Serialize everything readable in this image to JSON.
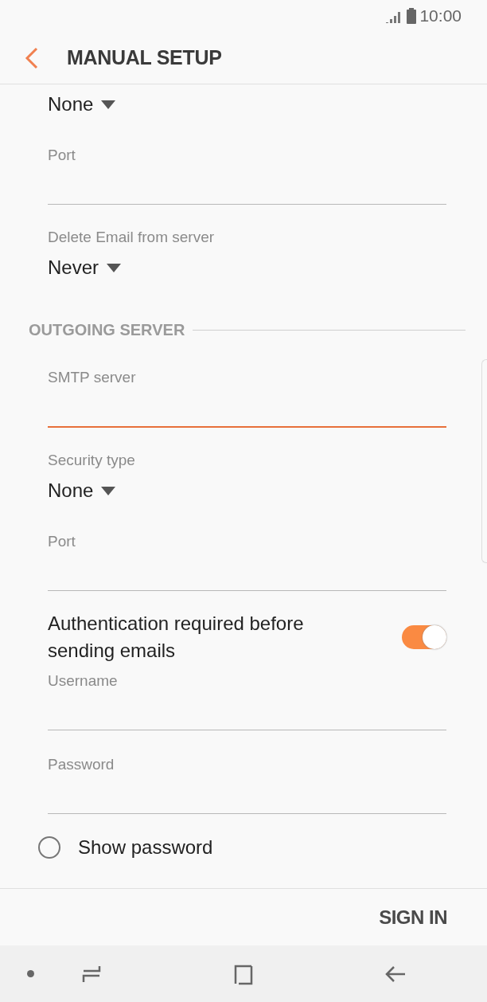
{
  "status_bar": {
    "time": "10:00"
  },
  "header": {
    "title": "MANUAL SETUP"
  },
  "items": [
    {
      "kind": "dropdown",
      "value": "None"
    },
    {
      "kind": "field",
      "label": "Port",
      "focused": false
    },
    {
      "kind": "dropdown",
      "label": "Delete Email from server",
      "value": "Never"
    },
    {
      "kind": "section",
      "label": "OUTGOING SERVER"
    },
    {
      "kind": "field",
      "label": "SMTP server",
      "focused": true
    },
    {
      "kind": "dropdown",
      "label": "Security type",
      "value": "None"
    },
    {
      "kind": "field",
      "label": "Port",
      "focused": false
    },
    {
      "kind": "toggle",
      "label": "Authentication required before sending emails",
      "on": true
    },
    {
      "kind": "field",
      "label": "Username",
      "focused": false
    },
    {
      "kind": "field",
      "label": "Password",
      "focused": false
    },
    {
      "kind": "checkbox",
      "label": "Show password",
      "checked": false
    }
  ],
  "footer": {
    "button": "SIGN IN"
  }
}
